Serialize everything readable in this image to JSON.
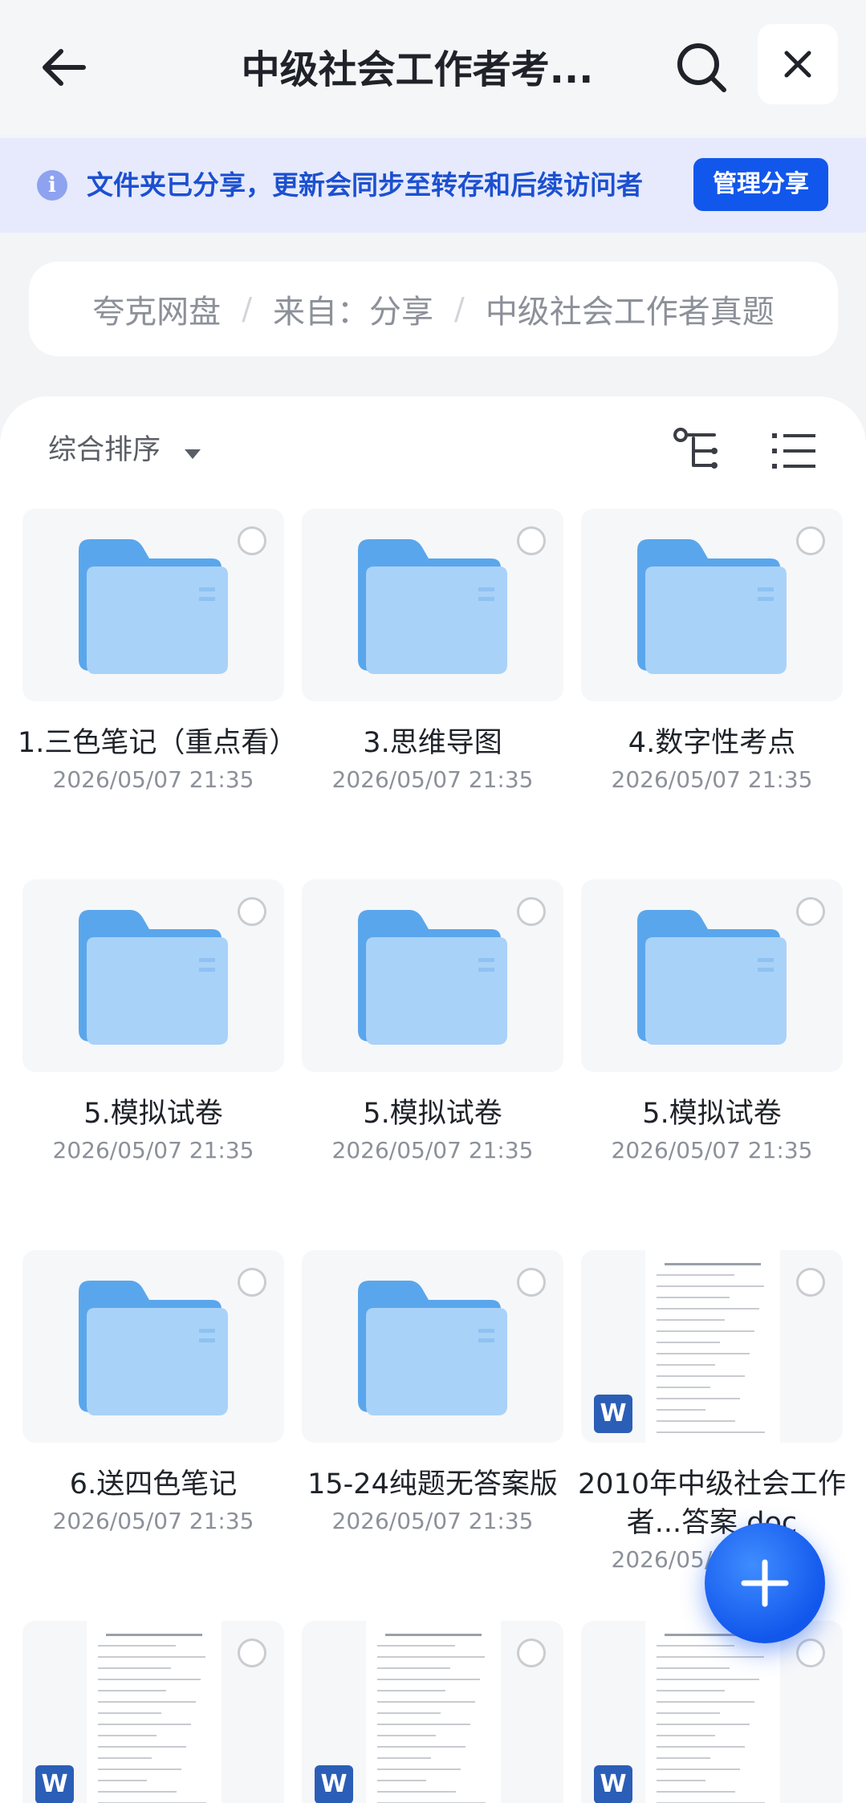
{
  "header": {
    "title": "中级社会工作者考...",
    "back_icon": "arrow-left-icon",
    "search_icon": "search-icon",
    "close_icon": "close-icon"
  },
  "banner": {
    "icon": "info-icon",
    "icon_glyph": "i",
    "text": "文件夹已分享，更新会同步至转存和后续访问者",
    "button_label": "管理分享",
    "accent_color": "#1257ec"
  },
  "breadcrumb": {
    "items": [
      "夸克网盘",
      "来自：分享",
      "中级社会工作者真题"
    ],
    "separator": "/"
  },
  "toolbar": {
    "sort_label": "综合排序",
    "tree_icon": "tree-view-icon",
    "list_icon": "list-view-icon"
  },
  "files": [
    {
      "type": "folder",
      "name": "1.三色笔记（重点看）",
      "date": "2026/05/07 21:35"
    },
    {
      "type": "folder",
      "name": "3.思维导图",
      "date": "2026/05/07 21:35"
    },
    {
      "type": "folder",
      "name": "4.数字性考点",
      "date": "2026/05/07 21:35"
    },
    {
      "type": "folder",
      "name": "5.模拟试卷",
      "date": "2026/05/07 21:35"
    },
    {
      "type": "folder",
      "name": "5.模拟试卷",
      "date": "2026/05/07 21:35"
    },
    {
      "type": "folder",
      "name": "5.模拟试卷",
      "date": "2026/05/07 21:35"
    },
    {
      "type": "folder",
      "name": "6.送四色笔记",
      "date": "2026/05/07 21:35"
    },
    {
      "type": "folder",
      "name": "15-24纯题无答案版",
      "date": "2026/05/07 21:35"
    },
    {
      "type": "doc",
      "name": "2010年中级社会工作者...答案.doc",
      "date": "2026/05/07 21:35",
      "badge": "W"
    },
    {
      "type": "doc",
      "name": "",
      "date": "",
      "badge": "W"
    },
    {
      "type": "doc",
      "name": "",
      "date": "",
      "badge": "W"
    },
    {
      "type": "doc",
      "name": "",
      "date": "",
      "badge": "W"
    }
  ],
  "fab": {
    "icon": "plus-icon"
  }
}
